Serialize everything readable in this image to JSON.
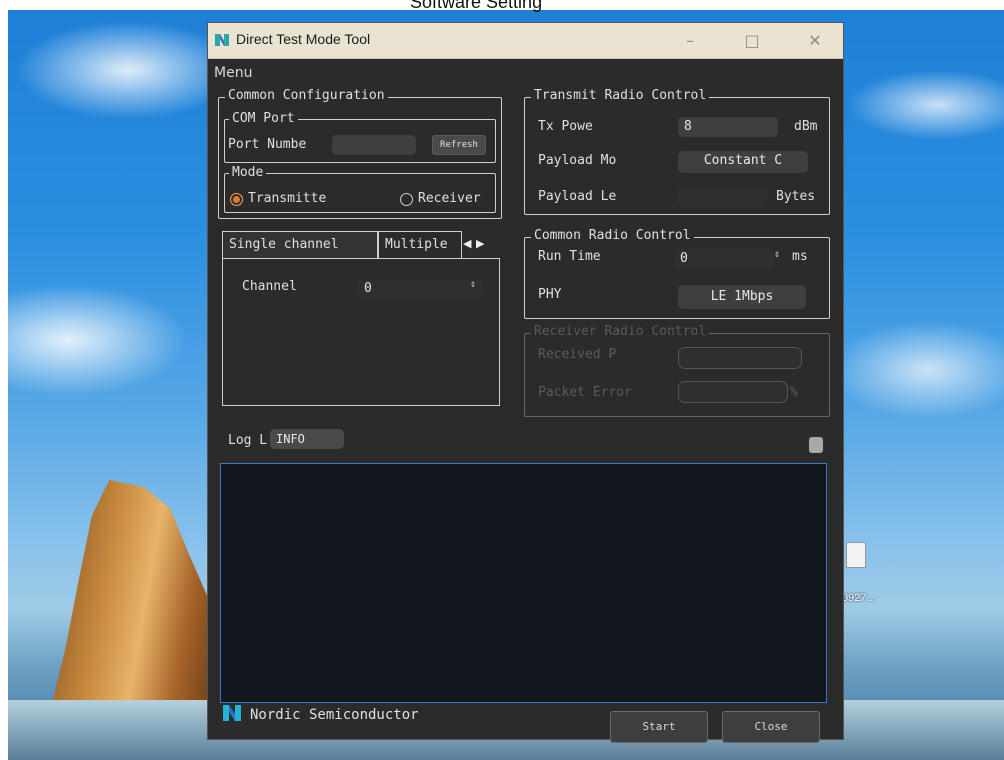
{
  "page_caption": "Software Setting",
  "desktop": {
    "icon_label": "0927..."
  },
  "window": {
    "title": "Direct Test Mode Tool",
    "minimize": "–",
    "maximize": "□",
    "close": "✕",
    "menu": "Menu"
  },
  "common_config": {
    "title": "Common Configuration",
    "com_port": {
      "title": "COM Port",
      "port_label": "Port Numbe",
      "port_value": "",
      "refresh": "Refresh"
    },
    "mode": {
      "title": "Mode",
      "transmitter": "Transmitte",
      "receiver": "Receiver",
      "selected": "transmitter"
    },
    "tabs": {
      "single": "Single channel",
      "multiple": "Multiple",
      "channel_label": "Channel",
      "channel_value": "0"
    }
  },
  "tx_control": {
    "title": "Transmit Radio Control",
    "tx_power_label": "Tx Powe",
    "tx_power_value": "8",
    "tx_power_unit": "dBm",
    "payload_mode_label": "Payload Mo",
    "payload_mode_value": "Constant C",
    "payload_len_label": "Payload Le",
    "payload_len_unit": "Bytes"
  },
  "common_radio": {
    "title": "Common Radio Control",
    "run_time_label": "Run Time",
    "run_time_value": "0",
    "run_time_unit": "ms",
    "phy_label": "PHY",
    "phy_value": "LE 1Mbps"
  },
  "rx_control": {
    "title": "Receiver Radio Control",
    "received_label": "Received P",
    "packet_error_label": "Packet Error",
    "percent": "%"
  },
  "log": {
    "label": "Log L",
    "level": "INFO"
  },
  "footer": {
    "brand": "Nordic Semiconductor",
    "start": "Start",
    "close": "Close"
  },
  "colors": {
    "window_bg": "#2b2b2b",
    "accent_radio": "#e07b2c",
    "log_border": "#3b78c4"
  }
}
